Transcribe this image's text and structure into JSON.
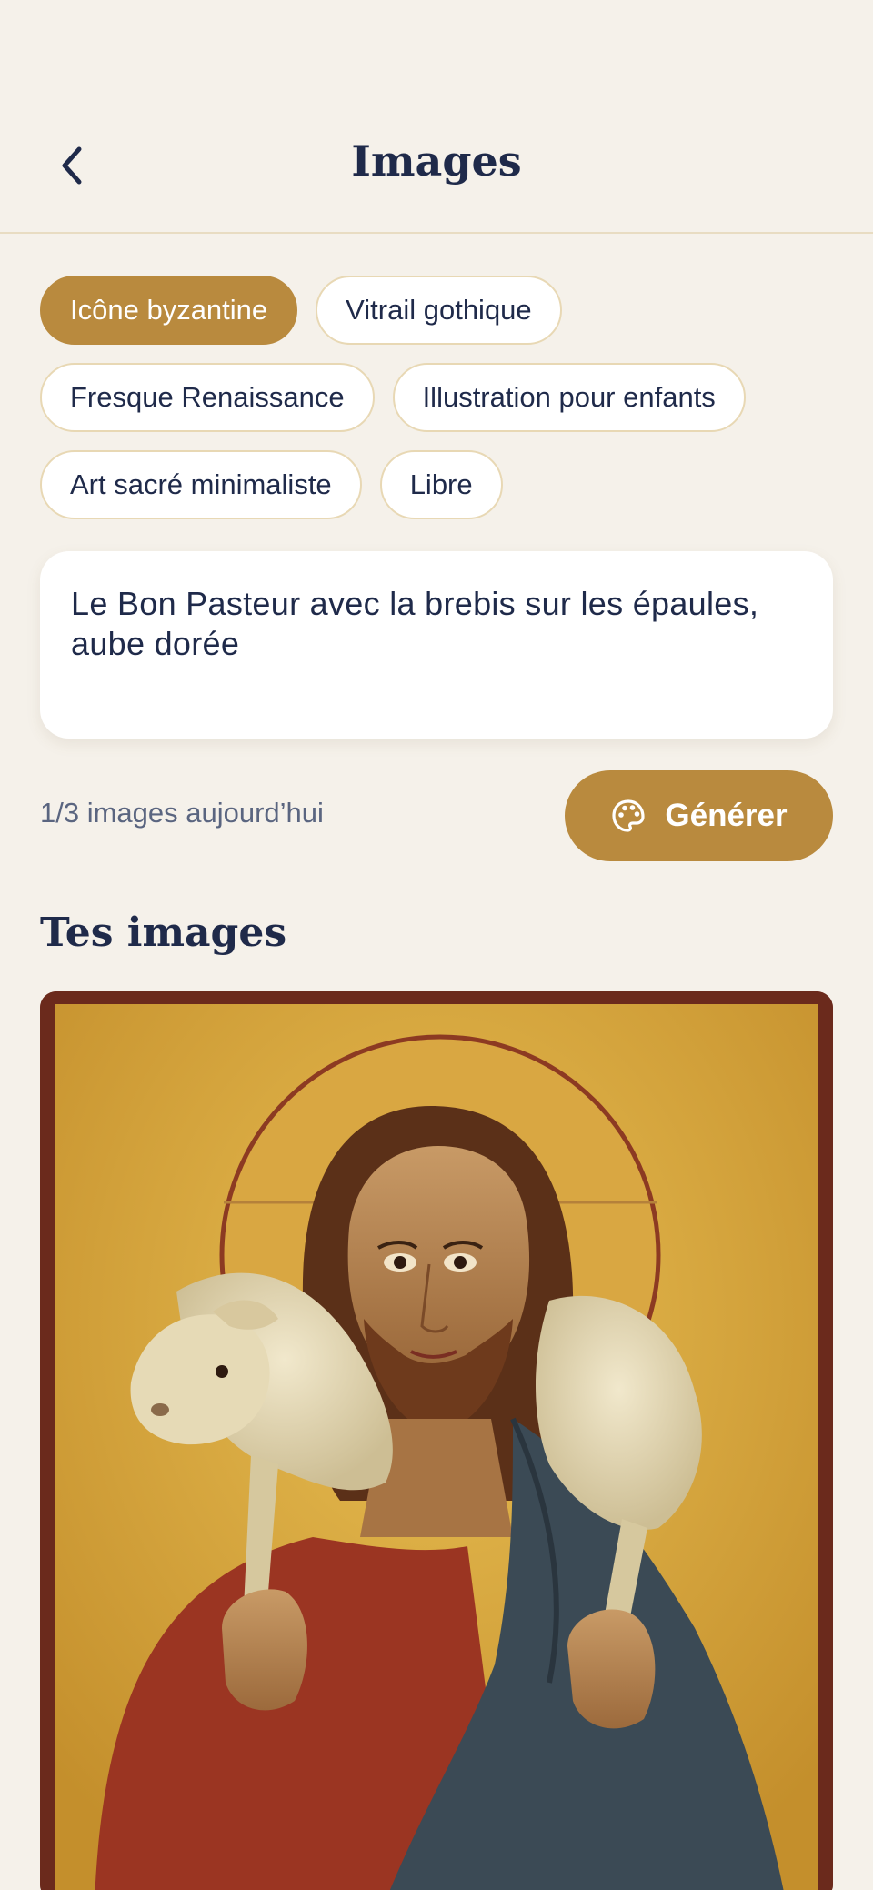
{
  "header": {
    "title": "Images"
  },
  "styles": [
    {
      "label": "Icône byzantine",
      "active": true
    },
    {
      "label": "Vitrail gothique",
      "active": false
    },
    {
      "label": "Fresque Renaissance",
      "active": false
    },
    {
      "label": "Illustration pour enfants",
      "active": false
    },
    {
      "label": "Art sacré minimaliste",
      "active": false
    },
    {
      "label": "Libre",
      "active": false
    }
  ],
  "prompt": {
    "value": "Le Bon Pasteur avec la brebis sur les épaules, aube dorée"
  },
  "quota": {
    "text": "1/3 images aujourd’hui"
  },
  "generate": {
    "label": "Générer",
    "icon": "palette-icon"
  },
  "gallery": {
    "title": "Tes images",
    "items": [
      {
        "subject": "Byzantine icon of the Good Shepherd carrying a lamb on his shoulders"
      }
    ]
  },
  "colors": {
    "accent": "#B98A3E",
    "background": "#F5F1EA",
    "text": "#1F2A4A",
    "chip_border": "#E8D8B4"
  }
}
